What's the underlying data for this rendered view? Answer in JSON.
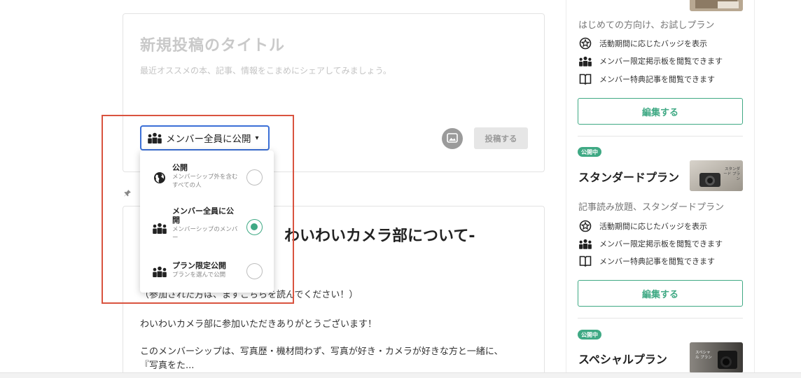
{
  "composer": {
    "title_placeholder": "新規投稿のタイトル",
    "body_placeholder": "最近オススメの本、記事、情報をこまめにシェアしてみましょう。",
    "visibility_label": "メンバー全員に公開",
    "visibility_caret": "▾",
    "post_button": "投稿する",
    "image_icon": "image-icon"
  },
  "visibility_menu": {
    "options": [
      {
        "label": "公開",
        "description": "メンバーシップ外を含むすべての人",
        "icon": "globe-icon",
        "selected": false
      },
      {
        "label": "メンバー全員に公開",
        "description": "メンバーシップのメンバー",
        "icon": "members-icon",
        "selected": true
      },
      {
        "label": "プラン限定公開",
        "description": "プランを選んで公開",
        "icon": "members-icon",
        "selected": false
      }
    ]
  },
  "pinned_post": {
    "pin_icon": "pin-icon",
    "heading": "わいわいカメラ部について-",
    "line1": "（参加された方は、まずこちらを読んでください！）",
    "line2": "わいわいカメラ部に参加いただきありがとうございます！",
    "line3": "このメンバーシップは、写真歴・機材問わず、写真が好き・カメラが好きな方と一緒に、",
    "line4": "『写真をた..."
  },
  "sidebar": {
    "plans": [
      {
        "description": "はじめての方向け、お試しプラン",
        "benefits": [
          "活動期間に応じたバッジを表示",
          "メンバー限定掲示板を閲覧できます",
          "メンバー特典記事を閲覧できます"
        ],
        "edit_label": "編集する"
      },
      {
        "status": "公開中",
        "name": "スタンダードプラン",
        "thumb_text": "スタンダード プラン",
        "description": "記事読み放題、スタンダードプラン",
        "benefits": [
          "活動期間に応じたバッジを表示",
          "メンバー限定掲示板を閲覧できます",
          "メンバー特典記事を閲覧できます"
        ],
        "edit_label": "編集する"
      },
      {
        "status": "公開中",
        "name": "スペシャルプラン",
        "thumb_text": "スペシャル プラン"
      }
    ]
  },
  "colors": {
    "accent_green": "#3fa984",
    "focus_blue": "#3b6fd6",
    "highlight_red": "#d9533f"
  }
}
